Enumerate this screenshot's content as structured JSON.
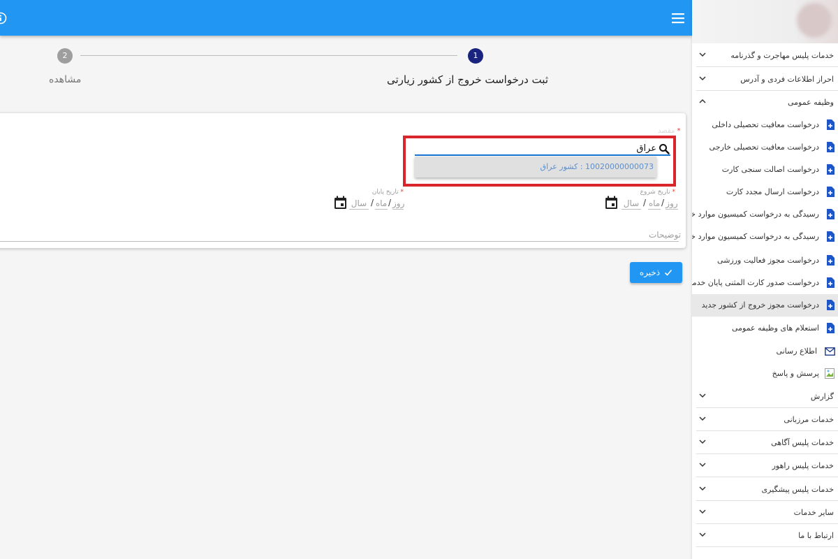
{
  "header": {
    "menu_icon": "hamburger-menu-icon",
    "info_icon": "info-icon",
    "color": "#2196f3"
  },
  "stepper": {
    "steps": [
      {
        "number": "1",
        "label": "ثبت درخواست خروج از کشور زیارتی",
        "active": true
      },
      {
        "number": "2",
        "label": "مشاهده",
        "active": false
      }
    ]
  },
  "form": {
    "destination": {
      "label": "مقصد",
      "required_mark": "*",
      "value": "عراق"
    },
    "autocomplete": {
      "option": "10020000000073 : کشور عراق"
    },
    "start_date": {
      "label": "تاریخ شروع",
      "required_mark": "*",
      "day": "روز",
      "month": "ماه",
      "year": "سال",
      "separator": "/"
    },
    "end_date": {
      "label": "تاریخ پایان",
      "required_mark": "*",
      "day": "روز",
      "month": "ماه",
      "year": "سال",
      "separator": "/"
    },
    "description": {
      "label": "توضیحات"
    },
    "save_label": "ذخیره"
  },
  "sidebar": {
    "items": [
      {
        "label": "خدمات پلیس مهاجرت و گذرنامه"
      },
      {
        "label": "احراز اطلاعات فردی و آدرس"
      },
      {
        "label": "وظیفه عمومی"
      }
    ],
    "sub_items": [
      {
        "label": "درخواست معافیت تحصیلی داخلی"
      },
      {
        "label": "درخواست معافیت تحصیلی خارجی"
      },
      {
        "label": "درخواست اصالت سنجی کارت"
      },
      {
        "label": "درخواست ارسال مجدد کارت"
      },
      {
        "label": "رسیدگی به درخواست کمیسیون موارد خاص"
      },
      {
        "label": "رسیدگی به درخواست کمیسیون موارد خاص"
      },
      {
        "label": "درخواست مجوز فعالیت ورزشی"
      },
      {
        "label": "درخواست صدور کارت المثنی پایان خدمت"
      },
      {
        "label": "درخواست مجوز خروج از کشور جدید"
      },
      {
        "label": "استعلام های وظیفه عمومی"
      },
      {
        "label": "اطلاع رسانی"
      },
      {
        "label": "پرسش و پاسخ"
      }
    ],
    "bottom_items": [
      {
        "label": "گزارش"
      },
      {
        "label": "خدمات مرزبانی"
      },
      {
        "label": "خدمات پلیس آگاهی"
      },
      {
        "label": "خدمات پلیس راهور"
      },
      {
        "label": "خدمات پلیس پیشگیری"
      },
      {
        "label": "سایر خدمات"
      },
      {
        "label": "ارتباط با ما"
      }
    ]
  }
}
